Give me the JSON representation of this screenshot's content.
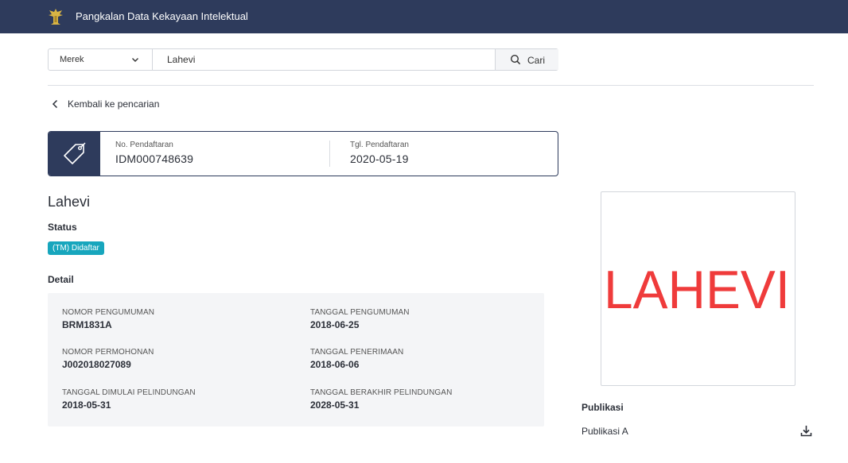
{
  "header": {
    "title": "Pangkalan Data Kekayaan Intelektual",
    "logo_icon": "garuda-emblem-icon"
  },
  "search": {
    "type_selected": "Merek",
    "query": "Lahevi",
    "button_label": "Cari"
  },
  "nav": {
    "back_label": "Kembali ke pencarian"
  },
  "registration": {
    "number_label": "No. Pendaftaran",
    "number_value": "IDM000748639",
    "date_label": "Tgl. Pendaftaran",
    "date_value": "2020-05-19"
  },
  "mark": {
    "name": "Lahevi",
    "image_text": "LAHEVI"
  },
  "status": {
    "label": "Status",
    "badge": "(TM) Didaftar",
    "badge_color": "#17a6bd"
  },
  "detail": {
    "label": "Detail",
    "items": [
      {
        "key": "NOMOR PENGUMUMAN",
        "value": "BRM1831A"
      },
      {
        "key": "TANGGAL PENGUMUMAN",
        "value": "2018-06-25"
      },
      {
        "key": "NOMOR PERMOHONAN",
        "value": "J002018027089"
      },
      {
        "key": "TANGGAL PENERIMAAN",
        "value": "2018-06-06"
      },
      {
        "key": "TANGGAL DIMULAI PELINDUNGAN",
        "value": "2018-05-31"
      },
      {
        "key": "TANGGAL BERAKHIR PELINDUNGAN",
        "value": "2028-05-31"
      }
    ]
  },
  "publication": {
    "label": "Publikasi",
    "items": [
      {
        "label": "Publikasi A",
        "icon": "download-icon"
      }
    ]
  },
  "colors": {
    "navy": "#2e3b5c",
    "mark_red": "#ef3b3b"
  }
}
